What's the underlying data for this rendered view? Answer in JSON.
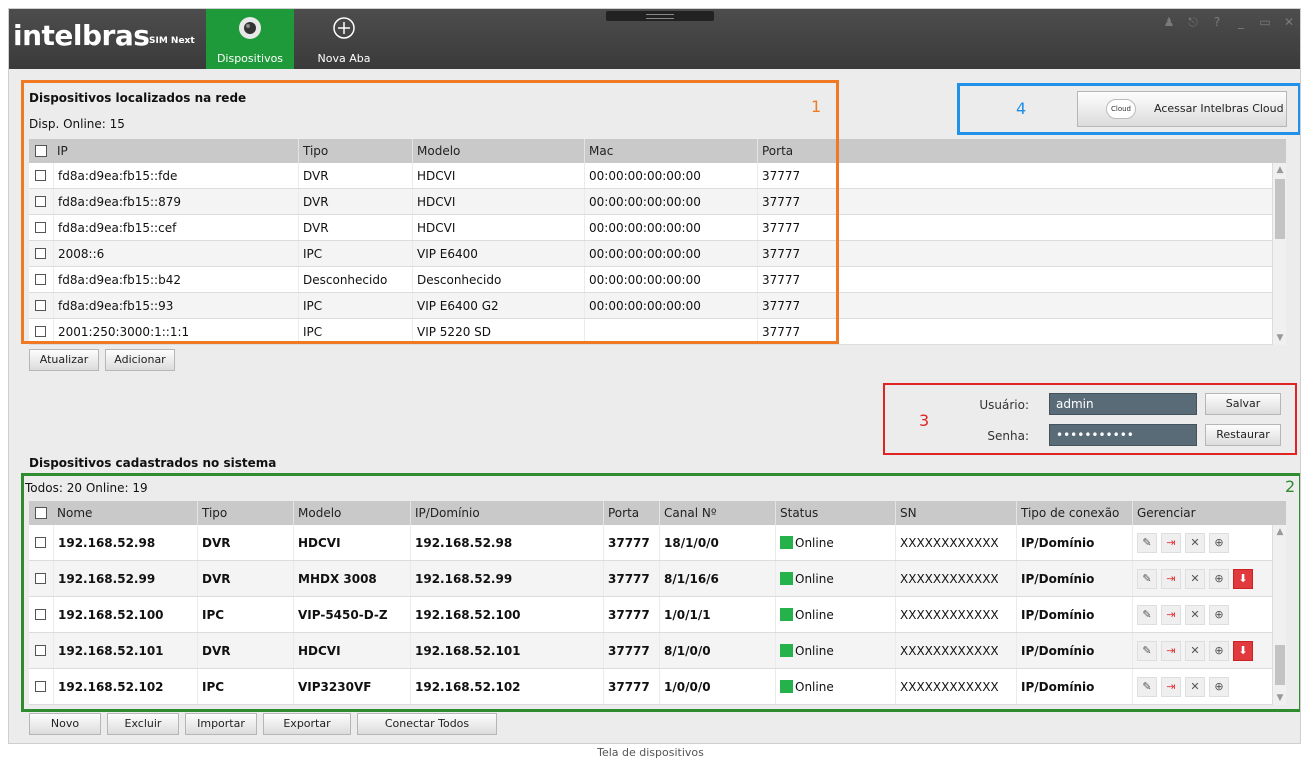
{
  "app": {
    "logo": "intelbras",
    "logo_sub": "SIM Next",
    "tabs": [
      {
        "label": "Dispositivos",
        "icon": "camera-icon"
      },
      {
        "label": "Nova Aba",
        "icon": "plus-circle-icon"
      }
    ],
    "window_controls": [
      "user-icon",
      "lock-icon",
      "help-icon",
      "minimize-icon",
      "maximize-icon",
      "close-icon"
    ]
  },
  "found": {
    "title": "Dispositivos localizados na rede",
    "online_label": "Disp. Online:",
    "online_count": "15",
    "columns": [
      "IP",
      "Tipo",
      "Modelo",
      "Mac",
      "Porta"
    ],
    "rows": [
      {
        "ip": "fd8a:d9ea:fb15::fde",
        "tipo": "DVR",
        "modelo": "HDCVI",
        "mac": "00:00:00:00:00:00",
        "porta": "37777"
      },
      {
        "ip": "fd8a:d9ea:fb15::879",
        "tipo": "DVR",
        "modelo": "HDCVI",
        "mac": "00:00:00:00:00:00",
        "porta": "37777"
      },
      {
        "ip": "fd8a:d9ea:fb15::cef",
        "tipo": "DVR",
        "modelo": "HDCVI",
        "mac": "00:00:00:00:00:00",
        "porta": "37777"
      },
      {
        "ip": "2008::6",
        "tipo": "IPC",
        "modelo": "VIP E6400",
        "mac": "00:00:00:00:00:00",
        "porta": "37777"
      },
      {
        "ip": "fd8a:d9ea:fb15::b42",
        "tipo": "Desconhecido",
        "modelo": "Desconhecido",
        "mac": "00:00:00:00:00:00",
        "porta": "37777"
      },
      {
        "ip": "fd8a:d9ea:fb15::93",
        "tipo": "IPC",
        "modelo": "VIP E6400 G2",
        "mac": "00:00:00:00:00:00",
        "porta": "37777"
      },
      {
        "ip": "2001:250:3000:1::1:1",
        "tipo": "IPC",
        "modelo": "VIP 5220 SD",
        "mac": "",
        "porta": "37777"
      }
    ],
    "buttons": {
      "refresh": "Atualizar",
      "add": "Adicionar"
    }
  },
  "cloud": {
    "button": "Acessar Intelbras Cloud",
    "icon_text": "Cloud"
  },
  "login": {
    "user_label": "Usuário:",
    "user_value": "admin",
    "pass_label": "Senha:",
    "pass_value": "•••••••••••",
    "save": "Salvar",
    "restore": "Restaurar"
  },
  "registered": {
    "title": "Dispositivos cadastrados no sistema",
    "total_label": "Todos:",
    "total": "20",
    "online_label": "Online:",
    "online": "19",
    "columns": [
      "Nome",
      "Tipo",
      "Modelo",
      "IP/Domínio",
      "Porta",
      "Canal Nº",
      "Status",
      "SN",
      "Tipo de conexão",
      "Gerenciar"
    ],
    "rows": [
      {
        "nome": "192.168.52.98",
        "tipo": "DVR",
        "modelo": "HDCVI",
        "ip": "192.168.52.98",
        "porta": "37777",
        "canal": "18/1/0/0",
        "status": "Online",
        "sn": "XXXXXXXXXXXX",
        "conexao": "IP/Domínio",
        "update": false
      },
      {
        "nome": "192.168.52.99",
        "tipo": "DVR",
        "modelo": "MHDX 3008",
        "ip": "192.168.52.99",
        "porta": "37777",
        "canal": "8/1/16/6",
        "status": "Online",
        "sn": "XXXXXXXXXXXX",
        "conexao": "IP/Domínio",
        "update": true
      },
      {
        "nome": "192.168.52.100",
        "tipo": "IPC",
        "modelo": "VIP-5450-D-Z",
        "ip": "192.168.52.100",
        "porta": "37777",
        "canal": "1/0/1/1",
        "status": "Online",
        "sn": "XXXXXXXXXXXX",
        "conexao": "IP/Domínio",
        "update": false
      },
      {
        "nome": "192.168.52.101",
        "tipo": "DVR",
        "modelo": "HDCVI",
        "ip": "192.168.52.101",
        "porta": "37777",
        "canal": "8/1/0/0",
        "status": "Online",
        "sn": "XXXXXXXXXXXX",
        "conexao": "IP/Domínio",
        "update": true
      },
      {
        "nome": "192.168.52.102",
        "tipo": "IPC",
        "modelo": "VIP3230VF",
        "ip": "192.168.52.102",
        "porta": "37777",
        "canal": "1/0/0/0",
        "status": "Online",
        "sn": "XXXXXXXXXXXX",
        "conexao": "IP/Domínio",
        "update": false
      }
    ],
    "buttons": {
      "new": "Novo",
      "delete": "Excluir",
      "import": "Importar",
      "export": "Exportar",
      "connect_all": "Conectar Todos"
    }
  },
  "annotations": {
    "one": "1",
    "two": "2",
    "three": "3",
    "four": "4"
  },
  "caption": "Tela de dispositivos",
  "colors": {
    "accent_green": "#1f9a3a",
    "status_online": "#25b24a",
    "highlight_orange": "#f07a23",
    "highlight_green": "#2e8b2e",
    "highlight_red": "#e02424",
    "highlight_blue": "#2190e8"
  }
}
